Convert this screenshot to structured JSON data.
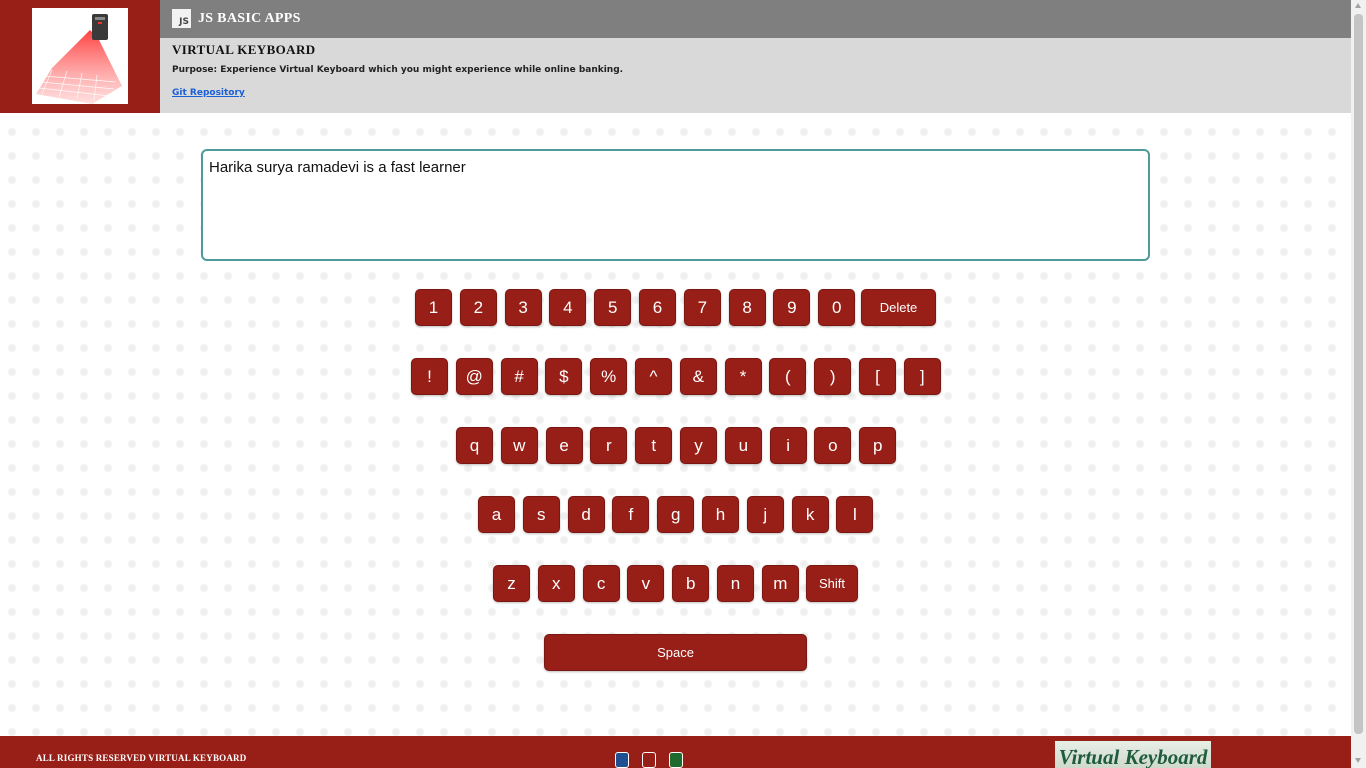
{
  "header": {
    "app_name": "JS BASIC APPS",
    "js_icon": "JS",
    "logo_icon": "virtual-keyboard-projector-icon",
    "page_title": "VIRTUAL KEYBOARD",
    "purpose": "Purpose: Experience Virtual Keyboard which you might experience while online banking.",
    "git_link": "Git Repository"
  },
  "textarea": {
    "value": "Harika surya ramadevi is a fast learner"
  },
  "keyboard": {
    "row_numbers": [
      "1",
      "2",
      "3",
      "4",
      "5",
      "6",
      "7",
      "8",
      "9",
      "0"
    ],
    "delete": "Delete",
    "row_symbols": [
      "!",
      "@",
      "#",
      "$",
      "%",
      "^",
      "&",
      "*",
      "(",
      ")",
      "[",
      "]"
    ],
    "row_qwerty": [
      "q",
      "w",
      "e",
      "r",
      "t",
      "y",
      "u",
      "i",
      "o",
      "p"
    ],
    "row_asdf": [
      "a",
      "s",
      "d",
      "f",
      "g",
      "h",
      "j",
      "k",
      "l"
    ],
    "row_zxcv": [
      "z",
      "x",
      "c",
      "v",
      "b",
      "n",
      "m"
    ],
    "shift": "Shift",
    "space": "Space"
  },
  "footer": {
    "rights": "ALL RIGHTS RESERVED VIRTUAL KEYBOARD",
    "theme_colors": [
      "#1f4f8f",
      "#981f17",
      "#1f6b2e"
    ],
    "logo_text": "Virtual Keyboard"
  },
  "colors": {
    "brand": "#981f17",
    "header_gray": "#7f7f7f",
    "info_gray": "#d9d9d9",
    "input_border": "#4f9a9a",
    "link": "#1a5fd6"
  }
}
